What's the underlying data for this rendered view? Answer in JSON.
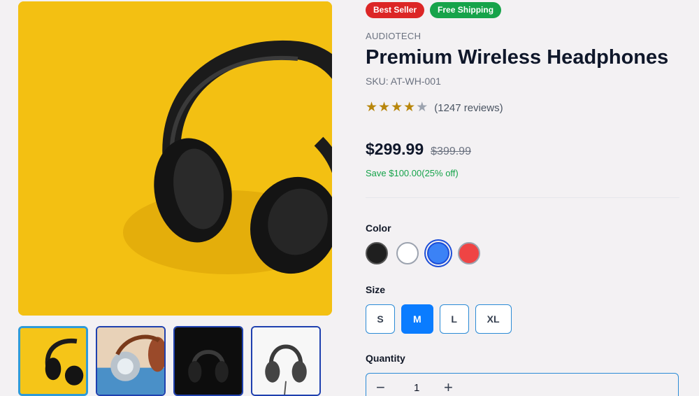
{
  "product": {
    "badges": [
      {
        "label": "Best Seller",
        "color": "#dc2626"
      },
      {
        "label": "Free Shipping",
        "color": "#16a34a"
      }
    ],
    "brand": "AUDIOTECH",
    "title": "Premium Wireless Headphones",
    "sku": "SKU: AT-WH-001",
    "rating": {
      "value": 4,
      "max": 5,
      "reviews_text": "(1247 reviews)"
    },
    "price": "$299.99",
    "original_price": "$399.99",
    "savings_text": "Save $100.00(25% off)"
  },
  "gallery": {
    "main_image": "headphones-on-yellow",
    "thumbnails": [
      "headphones-on-yellow",
      "headphones-closeup-blue",
      "headphones-dark",
      "headphones-white-studio"
    ],
    "selected_index": 0
  },
  "options": {
    "color_label": "Color",
    "colors": [
      {
        "name": "black",
        "hex": "#1f1f1f"
      },
      {
        "name": "white",
        "hex": "#ffffff"
      },
      {
        "name": "blue",
        "hex": "#3b82f6"
      },
      {
        "name": "red",
        "hex": "#ef4444"
      }
    ],
    "selected_color": "blue",
    "size_label": "Size",
    "sizes": [
      "S",
      "M",
      "L",
      "XL"
    ],
    "selected_size": "M"
  },
  "quantity": {
    "label": "Quantity",
    "value": "1",
    "minus_icon": "minus-icon",
    "plus_icon": "plus-icon"
  }
}
